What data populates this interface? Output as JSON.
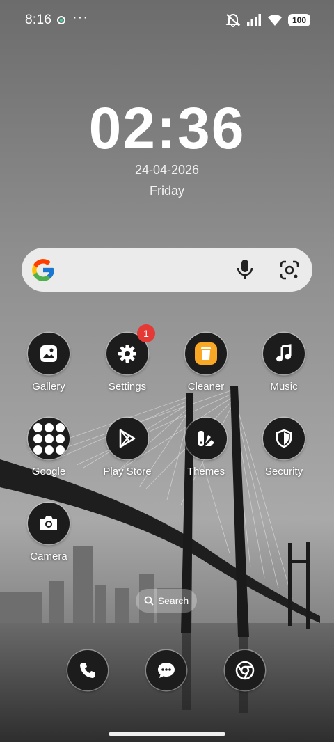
{
  "status_bar": {
    "time": "8:16",
    "more": "···",
    "battery": "100"
  },
  "clock": {
    "time": "02:36",
    "date": "24-04-2026",
    "day": "Friday"
  },
  "google_search": {
    "logo_colors": [
      "#4285F4",
      "#EA4335",
      "#FBBC05",
      "#34A853"
    ]
  },
  "apps": [
    {
      "label": "Gallery",
      "icon": "gallery-icon"
    },
    {
      "label": "Settings",
      "icon": "gear-icon",
      "badge": "1"
    },
    {
      "label": "Cleaner",
      "icon": "trash-icon",
      "accent": "#F9A825"
    },
    {
      "label": "Music",
      "icon": "music-note-icon"
    },
    {
      "label": "Google",
      "icon": "folder-icon"
    },
    {
      "label": "Play Store",
      "icon": "play-store-icon"
    },
    {
      "label": "Themes",
      "icon": "themes-icon"
    },
    {
      "label": "Security",
      "icon": "shield-icon"
    },
    {
      "label": "Camera",
      "icon": "camera-icon"
    }
  ],
  "search_pill": {
    "label": "Search"
  },
  "dock": [
    {
      "icon": "phone-icon"
    },
    {
      "icon": "messages-icon"
    },
    {
      "icon": "chrome-icon"
    }
  ],
  "colors": {
    "badge": "#E53935",
    "icon_bg": "#1C1C1C",
    "search_bar_bg": "#EBEBEB"
  }
}
